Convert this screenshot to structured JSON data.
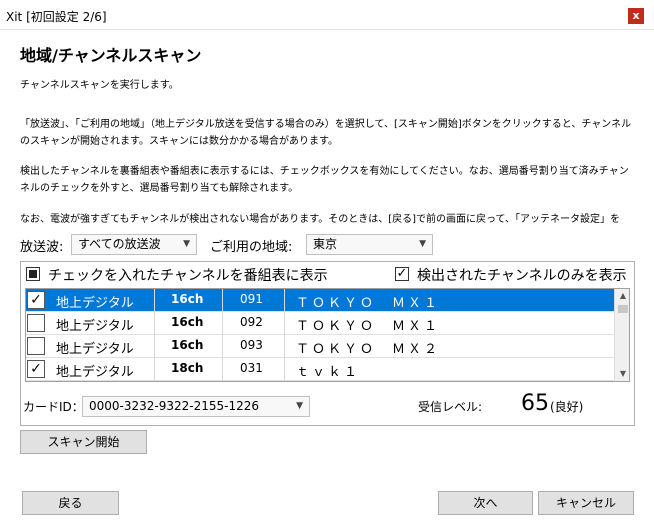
{
  "window": {
    "title": "Xit [初回設定 2/6]",
    "close": "x"
  },
  "page": {
    "heading": "地域/チャンネルスキャン",
    "p1": "チャンネルスキャンを実行します。",
    "p2": "「放送波」、「ご利用の地域」（地上デジタル放送を受信する場合のみ）を選択して、[スキャン開始]ボタンをクリックすると、チャンネルのスキャンが開始されます。スキャンには数分かかる場合があります。",
    "p3": "検出したチャンネルを裏番組表や番組表に表示するには、チェックボックスを有効にしてください。なお、選局番号割り当て済みチャンネルのチェックを外すと、選局番号割り当ても解除されます。",
    "p4": "なお、電波が強すぎてもチャンネルが検出されない場合があります。そのときは、[戻る]で前の画面に戻って、「アッテネータ設定」を"
  },
  "selectors": {
    "broadcast_label": "放送波:",
    "broadcast_value": "すべての放送波",
    "region_label": "ご利用の地域:",
    "region_value": "東京"
  },
  "options": {
    "show_checked_label": "チェックを入れたチャンネルを番組表に表示",
    "show_checked_state": "indeterminate",
    "only_detected_label": "検出されたチャンネルのみを表示",
    "only_detected_state": "checked"
  },
  "channels": [
    {
      "checked": true,
      "type": "地上デジタル",
      "ch": "16ch",
      "num": "091",
      "name": "ＴＯＫＹＯ　ＭＸ１",
      "selected": true
    },
    {
      "checked": false,
      "type": "地上デジタル",
      "ch": "16ch",
      "num": "092",
      "name": "ＴＯＫＹＯ　ＭＸ１",
      "selected": false
    },
    {
      "checked": false,
      "type": "地上デジタル",
      "ch": "16ch",
      "num": "093",
      "name": "ＴＯＫＹＯ　ＭＸ２",
      "selected": false
    },
    {
      "checked": true,
      "type": "地上デジタル",
      "ch": "18ch",
      "num": "031",
      "name": "ｔｖｋ１",
      "selected": false
    }
  ],
  "card": {
    "label": "カードID：",
    "value": "0000-3232-9322-2155-1226"
  },
  "signal": {
    "label": "受信レベル:",
    "value": "65",
    "quality": "(良好)"
  },
  "buttons": {
    "scan": "スキャン開始",
    "back": "戻る",
    "next": "次へ",
    "cancel": "キャンセル"
  },
  "colors": {
    "selection": "#0078d7",
    "close": "#c42b1c"
  }
}
